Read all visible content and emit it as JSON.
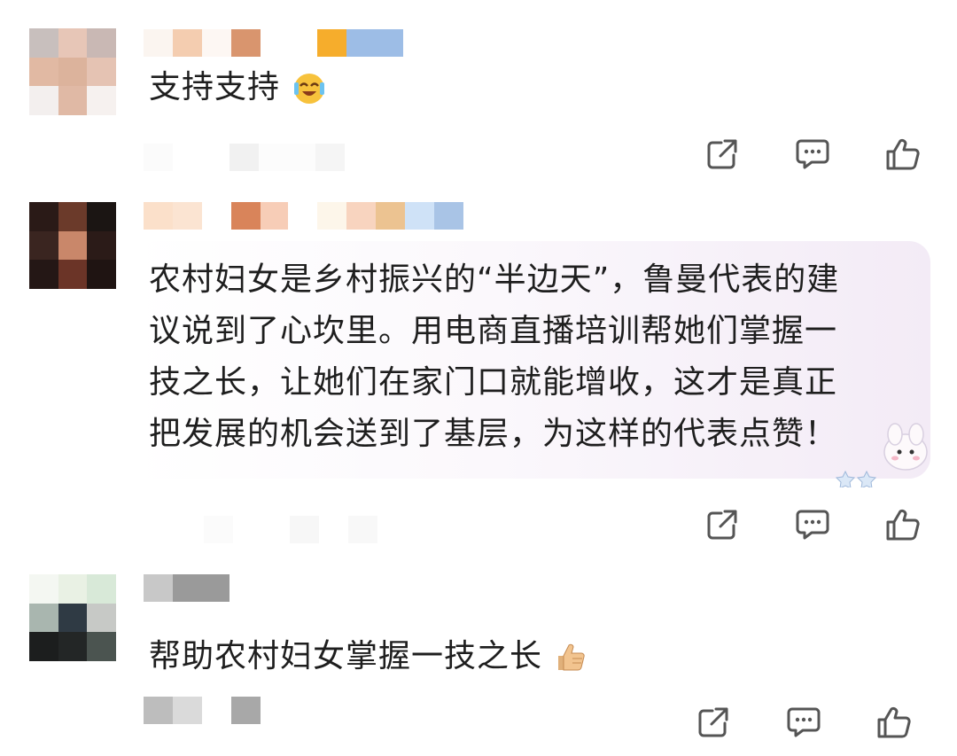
{
  "comments": [
    {
      "text": "支持支持",
      "emoji": "laughing-crying-face-icon"
    },
    {
      "text": "农村妇女是乡村振兴的“半边天”，鲁曼代表的建议说到了心坎里。用电商直播培训帮她们掌握一技之长，让她们在家门口就能增收，这才是真正把发展的机会送到了基层，为这样的代表点赞！",
      "lines": [
        "农村妇女是乡村振兴的“半边天”，鲁曼代表的建",
        "议说到了心坎里。用电商直播培训帮她们掌握一",
        "技之长，让她们在家门口就能增收，这才是真正",
        "把发展的机会送到了基层，为这样的代表点赞！"
      ],
      "sticker": "bunny-sticker"
    },
    {
      "text": "帮助农村妇女掌握一技之长",
      "emoji": "thumbs-up-emoji-icon"
    }
  ],
  "icons": {
    "share": "share-icon",
    "reply": "comment-icon",
    "like": "thumbs-up-icon"
  },
  "colors": {
    "text": "#1e1e1e",
    "icon": "#555555"
  }
}
